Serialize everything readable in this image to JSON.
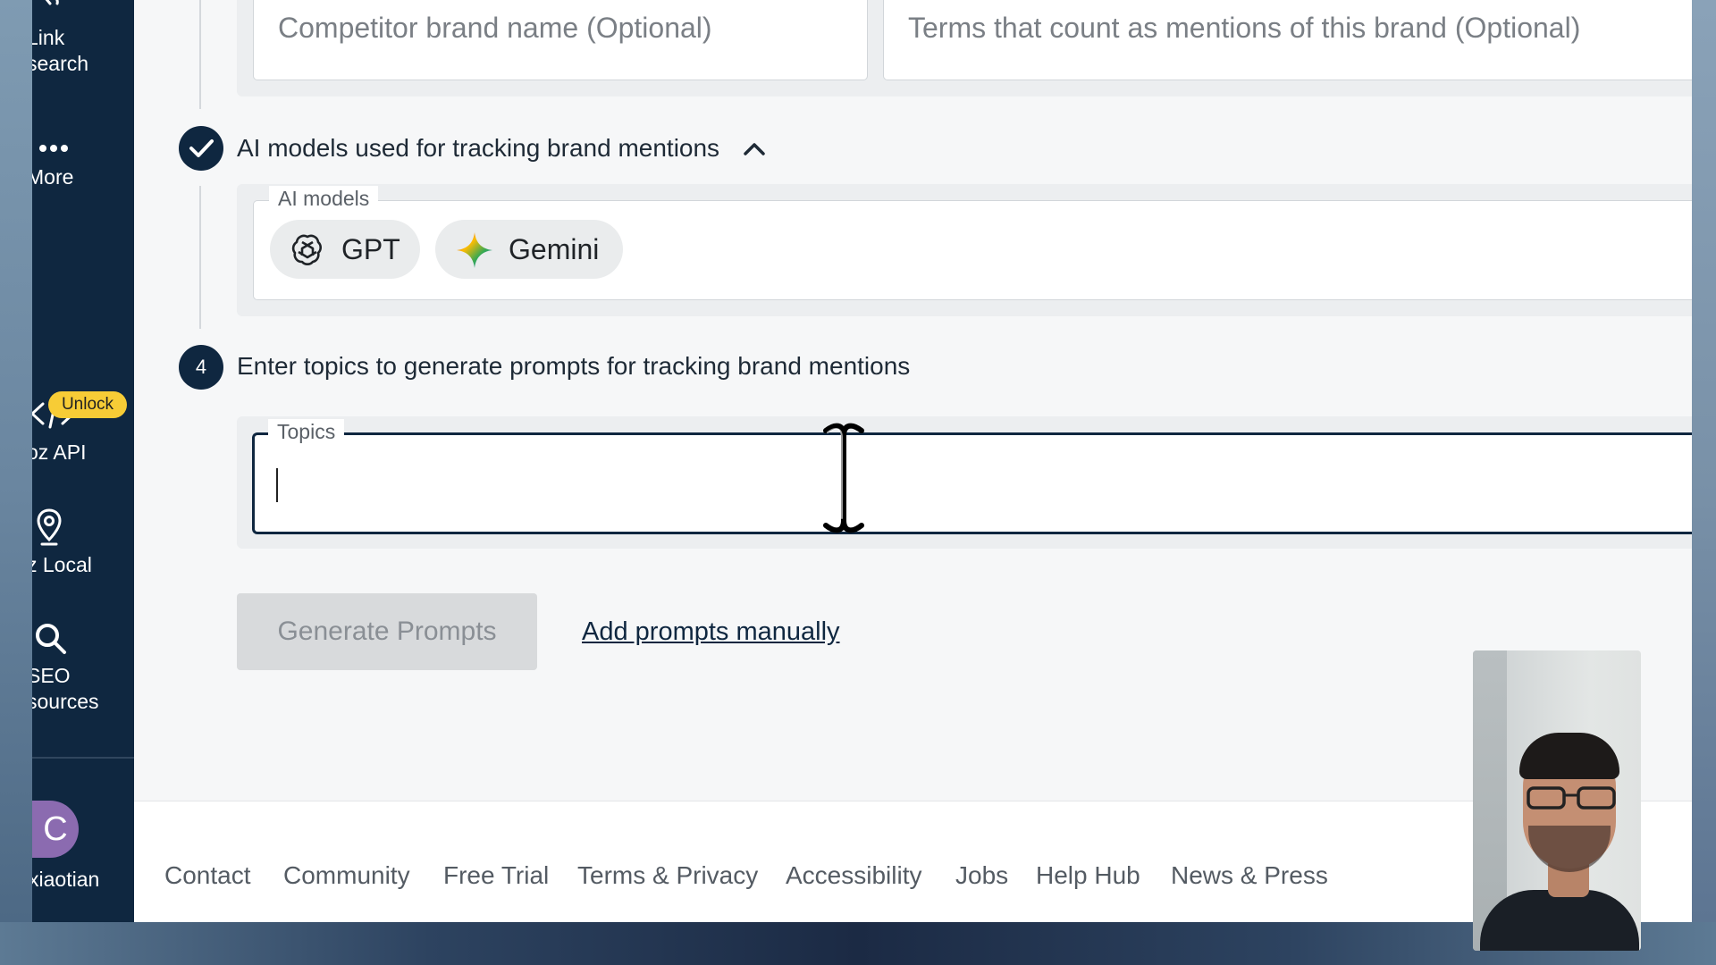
{
  "sidebar": {
    "items": [
      {
        "label": "Link\nsearch",
        "icon": "link-icon"
      },
      {
        "label": "More",
        "icon": "more-icon"
      },
      {
        "label": "oz API",
        "icon": "code-icon",
        "badge": "Unlock"
      },
      {
        "label": "z Local",
        "icon": "location-pin-icon"
      },
      {
        "label": "SEO\nsources",
        "icon": "search-icon"
      }
    ],
    "user": {
      "initial": "C",
      "name": "xiaotian"
    }
  },
  "brand_fields": {
    "competitor_placeholder": "Competitor brand name (Optional)",
    "terms_placeholder": "Terms that count as mentions of this brand (Optional)"
  },
  "ai_models_step": {
    "title": "AI models used for tracking brand mentions",
    "legend": "AI models",
    "models": [
      "GPT",
      "Gemini"
    ]
  },
  "topics_step": {
    "number": "4",
    "title": "Enter topics to generate prompts for tracking brand mentions",
    "legend": "Topics",
    "value": ""
  },
  "actions": {
    "generate_label": "Generate Prompts",
    "manual_label": "Add prompts manually"
  },
  "footer": {
    "links": [
      "Contact",
      "Community",
      "Free Trial",
      "Terms & Privacy",
      "Accessibility",
      "Jobs",
      "Help Hub",
      "News & Press"
    ]
  },
  "colors": {
    "sidebar": "#0f2740",
    "accent": "#0f2740",
    "badge": "#f7cc36",
    "avatar": "#8b6bb0"
  }
}
